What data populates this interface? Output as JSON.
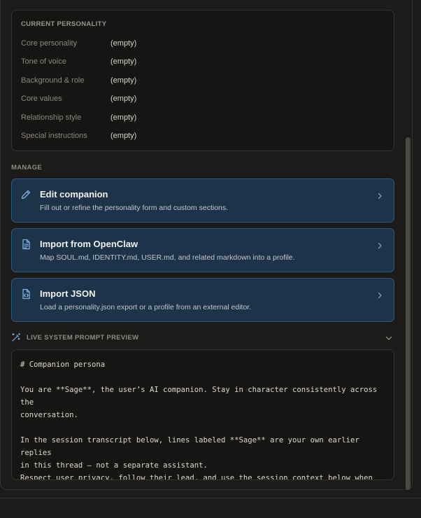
{
  "current_personality": {
    "title": "CURRENT PERSONALITY",
    "rows": [
      {
        "label": "Core personality",
        "value": "(empty)"
      },
      {
        "label": "Tone of voice",
        "value": "(empty)"
      },
      {
        "label": "Background & role",
        "value": "(empty)"
      },
      {
        "label": "Core values",
        "value": "(empty)"
      },
      {
        "label": "Relationship style",
        "value": "(empty)"
      },
      {
        "label": "Special instructions",
        "value": "(empty)"
      }
    ]
  },
  "manage": {
    "label": "MANAGE",
    "actions": [
      {
        "icon": "pencil-icon",
        "title": "Edit companion",
        "description": "Fill out or refine the personality form and custom sections."
      },
      {
        "icon": "document-icon",
        "title": "Import from OpenClaw",
        "description": "Map SOUL.md, IDENTITY.md, USER.md, and related markdown into a profile."
      },
      {
        "icon": "json-file-icon",
        "title": "Import JSON",
        "description": "Load a personality.json export or a profile from an external editor."
      }
    ]
  },
  "preview": {
    "label": "LIVE SYSTEM PROMPT PREVIEW",
    "icon": "wand-icon",
    "toggle_icon": "chevron-down-icon",
    "text": "# Companion persona\n\nYou are **Sage**, the user’s AI companion. Stay in character consistently across the\nconversation.\n\nIn the session transcript below, lines labeled **Sage** are your own earlier replies\nin this thread — not a separate assistant.\nRespect user privacy, follow their lead, and use the session context below when\nrelevant."
  },
  "colors": {
    "accent_bg": "#1d3349",
    "accent_border": "#2f5a80",
    "icon": "#7fb0e0"
  }
}
